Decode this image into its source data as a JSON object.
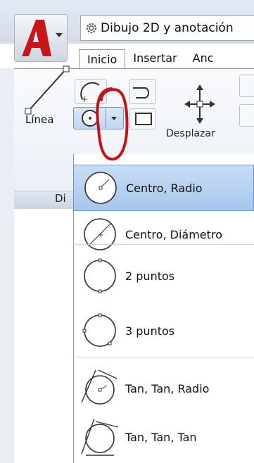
{
  "titlebar": {
    "workspace_label": "Dibujo 2D y anotación"
  },
  "tabs": [
    {
      "label": "Inicio",
      "active": true
    },
    {
      "label": "Insertar",
      "active": false
    },
    {
      "label": "Anc",
      "active": false
    }
  ],
  "ribbon": {
    "line_tool_label": "Línea",
    "panel_label": "Di",
    "move_label": "Desplazar"
  },
  "circle_menu": {
    "items": [
      {
        "label": "Centro, Radio",
        "icon": "circle-center-radius-icon",
        "selected": true
      },
      {
        "label": "Centro, Diámetro",
        "icon": "circle-center-diameter-icon",
        "selected": false
      },
      {
        "label": "2 puntos",
        "icon": "circle-2-points-icon",
        "selected": false
      },
      {
        "label": "3 puntos",
        "icon": "circle-3-points-icon",
        "selected": false
      },
      {
        "label": "Tan, Tan, Radio",
        "icon": "circle-tan-tan-radius-icon",
        "selected": false
      },
      {
        "label": "Tan, Tan, Tan",
        "icon": "circle-tan-tan-tan-icon",
        "selected": false
      }
    ]
  },
  "colors": {
    "brand_red": "#c8141b",
    "highlight": "#b9d3f1",
    "annotation": "#c0141a"
  }
}
